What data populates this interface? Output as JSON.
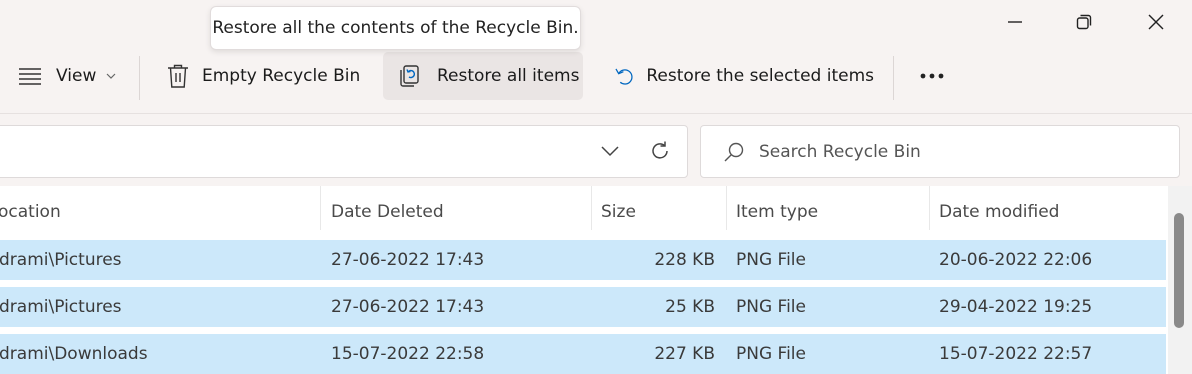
{
  "tooltip": {
    "text": "Restore all the contents of the Recycle Bin."
  },
  "toolbar": {
    "view_label": "View",
    "empty_label": "Empty Recycle Bin",
    "restore_all_label": "Restore all items",
    "restore_selected_label": "Restore the selected items",
    "more_label": "•••"
  },
  "search": {
    "placeholder": "Search Recycle Bin"
  },
  "columns": {
    "location": "ocation",
    "date_deleted": "Date Deleted",
    "size": "Size",
    "item_type": "Item type",
    "date_modified": "Date modified"
  },
  "rows": [
    {
      "location": "drami\\Pictures",
      "date_deleted": "27-06-2022 17:43",
      "size": "228 KB",
      "item_type": "PNG File",
      "date_modified": "20-06-2022 22:06"
    },
    {
      "location": "drami\\Pictures",
      "date_deleted": "27-06-2022 17:43",
      "size": "25 KB",
      "item_type": "PNG File",
      "date_modified": "29-04-2022 19:25"
    },
    {
      "location": "drami\\Downloads",
      "date_deleted": "15-07-2022 22:58",
      "size": "227 KB",
      "item_type": "PNG File",
      "date_modified": "15-07-2022 22:57"
    }
  ],
  "colors": {
    "selected_row": "#cce8fa",
    "accent": "#0067c0"
  }
}
